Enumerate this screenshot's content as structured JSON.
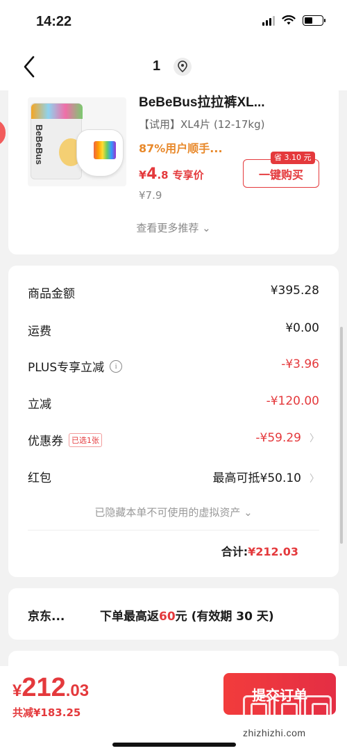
{
  "status_bar": {
    "time": "14:22",
    "battery_level": 0.45
  },
  "nav": {
    "title": "1"
  },
  "product": {
    "name": "BeBeBus拉拉裤XL...",
    "package_brand": "BeBeBus",
    "spec": "【试用】XL4片 (12-17kg)",
    "rating": "87%用户顺手...",
    "price_symbol": "¥",
    "price_int": "4",
    "price_dec": ".8",
    "price_tag": "专享价",
    "orig_price": "¥7.9",
    "save_badge": "省 3.10 元",
    "buy_button": "一键购买"
  },
  "more_recommend": "查看更多推荐 ⌄",
  "summary": {
    "rows": [
      {
        "label": "商品金额",
        "value": "¥395.28"
      },
      {
        "label": "运费",
        "value": "¥0.00"
      },
      {
        "label": "PLUS专享立减",
        "value": "-¥3.96"
      },
      {
        "label": "立减",
        "value": "-¥120.00"
      },
      {
        "label": "优惠券",
        "tag": "已选1张",
        "value": "-¥59.29"
      },
      {
        "label": "红包",
        "value": "最高可抵¥50.10"
      }
    ],
    "hidden_assets": "已隐藏本单不可使用的虚拟资产 ⌄",
    "total_label": "合计:",
    "total_amount": "¥212.03"
  },
  "rebate": {
    "left": "京东...",
    "prefix": "下单最高返",
    "amount": "60",
    "suffix": "元 (有效期 30 天)"
  },
  "bottom": {
    "price_symbol": "¥",
    "price_int": "212",
    "price_dec": ".03",
    "total_saved": "共减¥183.25",
    "submit": "提交订单"
  },
  "watermark": {
    "url": "zhizhizhi.com"
  },
  "colors": {
    "accent": "#e4393c",
    "orange": "#e8892b"
  }
}
